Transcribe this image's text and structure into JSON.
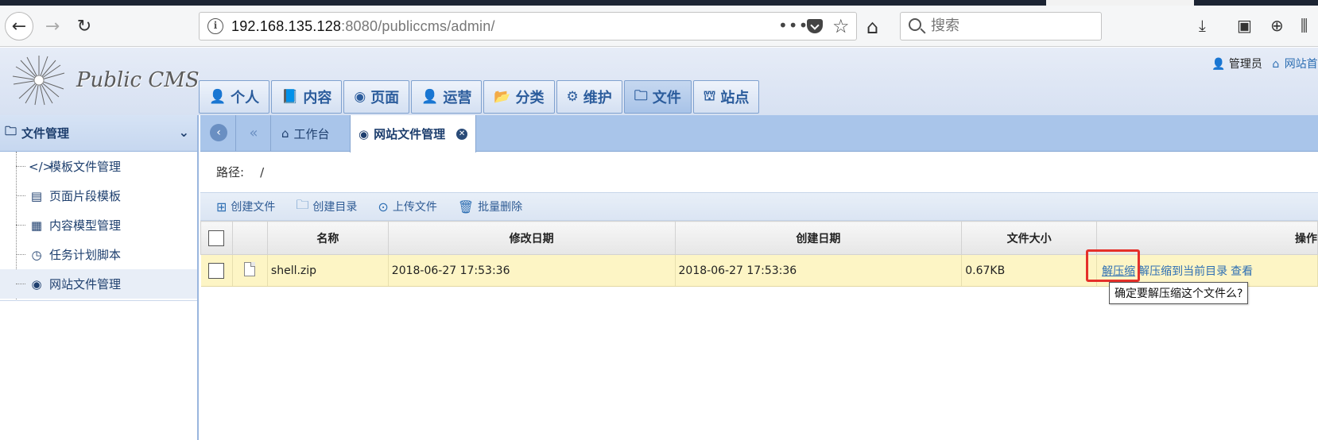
{
  "browser": {
    "url_host": "192.168.135.128",
    "url_port": ":8080",
    "url_path": "/publiccms/admin/",
    "search_placeholder": "搜索"
  },
  "header": {
    "logo_text": "Public CMS",
    "user_label": "管理员",
    "site_label": "网站首页",
    "nav": [
      {
        "label": "个人",
        "icon": "user-icon"
      },
      {
        "label": "内容",
        "icon": "book-icon"
      },
      {
        "label": "页面",
        "icon": "globe-icon"
      },
      {
        "label": "运营",
        "icon": "user-icon"
      },
      {
        "label": "分类",
        "icon": "folder-open-icon"
      },
      {
        "label": "维护",
        "icon": "gears-icon"
      },
      {
        "label": "文件",
        "icon": "folder-icon"
      },
      {
        "label": "站点",
        "icon": "sitemap-icon"
      }
    ]
  },
  "sidebar": {
    "title": "文件管理",
    "items": [
      {
        "label": "模板文件管理",
        "icon": "code-icon"
      },
      {
        "label": "页面片段模板",
        "icon": "list-icon"
      },
      {
        "label": "内容模型管理",
        "icon": "grid-icon"
      },
      {
        "label": "任务计划脚本",
        "icon": "clock-icon"
      },
      {
        "label": "网站文件管理",
        "icon": "globe-icon"
      }
    ]
  },
  "tabs": {
    "home": "工作台",
    "active": "网站文件管理"
  },
  "path": {
    "label": "路径:",
    "value": "/"
  },
  "toolbar": {
    "create_file": "创建文件",
    "create_dir": "创建目录",
    "upload": "上传文件",
    "batch_delete": "批量删除"
  },
  "table": {
    "headers": {
      "name": "名称",
      "modified": "修改日期",
      "created": "创建日期",
      "size": "文件大小",
      "actions": "操作"
    },
    "rows": [
      {
        "name": "shell.zip",
        "modified": "2018-06-27 17:53:36",
        "created": "2018-06-27 17:53:36",
        "size": "0.67KB",
        "actions": [
          "解压缩",
          "解压缩到当前目录",
          "查看"
        ]
      }
    ]
  },
  "tooltip": "确定要解压缩这个文件么?",
  "colors": {
    "accent": "#2e6fb3",
    "highlight_box": "#e5302a",
    "row_bg": "#fdf5c5"
  }
}
